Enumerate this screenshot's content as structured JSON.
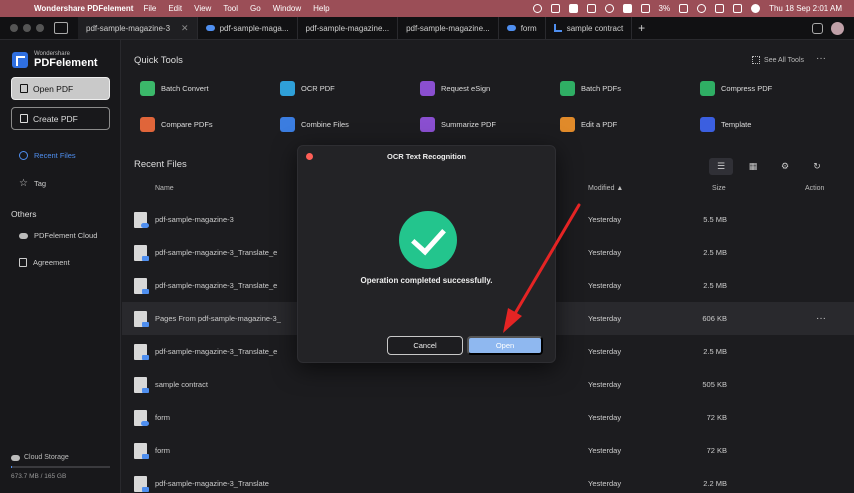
{
  "menubar": {
    "app_name": "Wondershare PDFelement",
    "menus": [
      "File",
      "Edit",
      "View",
      "Tool",
      "Go",
      "Window",
      "Help"
    ],
    "battery": "3%",
    "datetime": "Thu 18 Sep  2:01 AM"
  },
  "tabs": [
    {
      "label": "pdf-sample-magazine-3",
      "icon": "none"
    },
    {
      "label": "pdf-sample-maga...",
      "icon": "cloud-icon"
    },
    {
      "label": "pdf-sample-magazine...",
      "icon": "none"
    },
    {
      "label": "pdf-sample-magazine...",
      "icon": "none"
    },
    {
      "label": "form",
      "icon": "cloud-icon"
    },
    {
      "label": "sample contract",
      "icon": "chart-icon"
    }
  ],
  "sidebar": {
    "logo_small": "Wondershare",
    "logo_big": "PDFelement",
    "open_pdf": "Open PDF",
    "create_pdf": "Create PDF",
    "recent_files": "Recent Files",
    "tag": "Tag",
    "others": "Others",
    "cloud": "PDFelement Cloud",
    "agreement": "Agreement",
    "cloud_storage": "Cloud Storage",
    "storage_used": "673.7 MB / 165 GB",
    "storage_fraction": 0.004
  },
  "main": {
    "quick_tools_title": "Quick Tools",
    "see_all": "See All Tools",
    "tools": [
      {
        "label": "Batch Convert",
        "color": "#3bb86a"
      },
      {
        "label": "OCR PDF",
        "color": "#2fa0d8"
      },
      {
        "label": "Request eSign",
        "color": "#8a4fd0"
      },
      {
        "label": "Batch PDFs",
        "color": "#2fae64"
      },
      {
        "label": "Compress PDF",
        "color": "#2fae64"
      },
      {
        "label": "Compare PDFs",
        "color": "#e0653a"
      },
      {
        "label": "Combine Files",
        "color": "#3b7de0"
      },
      {
        "label": "Summarize PDF",
        "color": "#8a4fd0"
      },
      {
        "label": "Edit a PDF",
        "color": "#e08a2a"
      },
      {
        "label": "Template",
        "color": "#3b5fe0"
      }
    ],
    "recent_title": "Recent Files",
    "columns": {
      "name": "Name",
      "modified": "Modified ▲",
      "size": "Size",
      "action": "Action"
    },
    "files": [
      {
        "name": "pdf-sample-magazine-3",
        "modified": "Yesterday",
        "size": "5.5 MB",
        "icon": "cloud"
      },
      {
        "name": "pdf-sample-magazine-3_Translate_e",
        "modified": "Yesterday",
        "size": "2.5 MB",
        "icon": "pdf"
      },
      {
        "name": "pdf-sample-magazine-3_Translate_e",
        "modified": "Yesterday",
        "size": "2.5 MB",
        "icon": "pdf"
      },
      {
        "name": "Pages From pdf-sample-magazine-3_",
        "modified": "Yesterday",
        "size": "606 KB",
        "icon": "pdf",
        "highlight": true
      },
      {
        "name": "pdf-sample-magazine-3_Translate_e",
        "modified": "Yesterday",
        "size": "2.5 MB",
        "icon": "pdf"
      },
      {
        "name": "sample contract",
        "modified": "Yesterday",
        "size": "505 KB",
        "icon": "pdf"
      },
      {
        "name": "form",
        "modified": "Yesterday",
        "size": "72 KB",
        "icon": "cloud"
      },
      {
        "name": "form",
        "modified": "Yesterday",
        "size": "72 KB",
        "icon": "pdf"
      },
      {
        "name": "pdf-sample-magazine-3_Translate",
        "modified": "Yesterday",
        "size": "2.2 MB",
        "icon": "pdf"
      }
    ]
  },
  "dialog": {
    "title": "OCR Text Recognition",
    "message": "Operation completed successfully.",
    "cancel": "Cancel",
    "open": "Open",
    "success_color": "#23c58d"
  },
  "annotation_color": "#e52424"
}
